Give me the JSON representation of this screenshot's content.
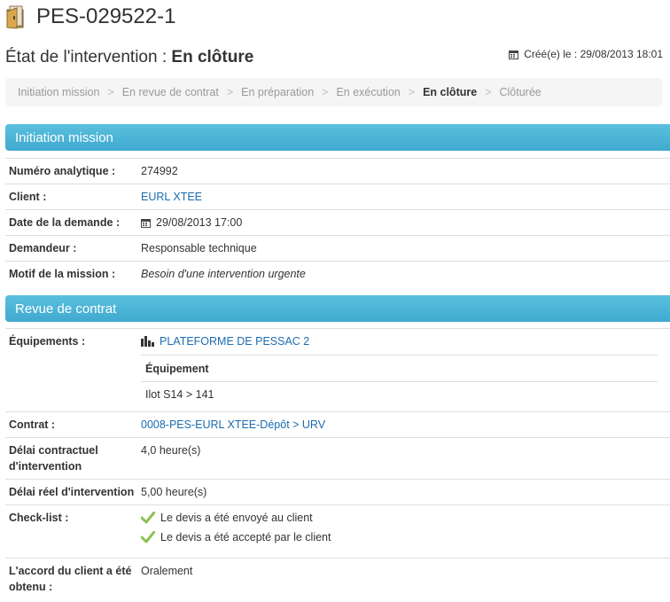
{
  "header": {
    "record_id": "PES-029522-1"
  },
  "status": {
    "prefix": "État de l'intervention : ",
    "value": "En clôture",
    "created": "Créé(e) le : 29/08/2013 18:01"
  },
  "breadcrumb": [
    "Initiation mission",
    "En revue de contrat",
    "En préparation",
    "En exécution",
    "En clôture",
    "Clôturée"
  ],
  "breadcrumb_sep": ">",
  "initiation": {
    "title": "Initiation mission",
    "numero_label": "Numéro analytique :",
    "numero_value": "274992",
    "client_label": "Client :",
    "client_value": "EURL XTEE",
    "date_label": "Date de la demande :",
    "date_value": "29/08/2013 17:00",
    "demandeur_label": "Demandeur :",
    "demandeur_value": "Responsable technique",
    "motif_label": "Motif de la mission :",
    "motif_value": "Besoin d'une intervention urgente"
  },
  "revue": {
    "title": "Revue de contrat",
    "equipements_label": "Équipements :",
    "plateforme": "PLATEFORME DE PESSAC 2",
    "sub_header": "Équipement",
    "sub_value": "Ilot S14 > 141",
    "contrat_label": "Contrat :",
    "contrat_value": "0008-PES-EURL XTEE-Dépôt > URV",
    "delai_contractuel_label": "Délai contractuel d'intervention",
    "delai_contractuel_value": "4,0 heure(s)",
    "delai_reel_label": "Délai réel d'intervention",
    "delai_reel_value": "5,00 heure(s)",
    "checklist_label": "Check-list :",
    "checklist": [
      "Le devis a été envoyé au client",
      "Le devis a été accepté par le client"
    ],
    "accord_label": "L'accord du client a été obtenu :",
    "accord_value": "Oralement"
  },
  "colors": {
    "section": "#4ab6da",
    "link": "#1b6bb0",
    "check": "#8cc152"
  }
}
